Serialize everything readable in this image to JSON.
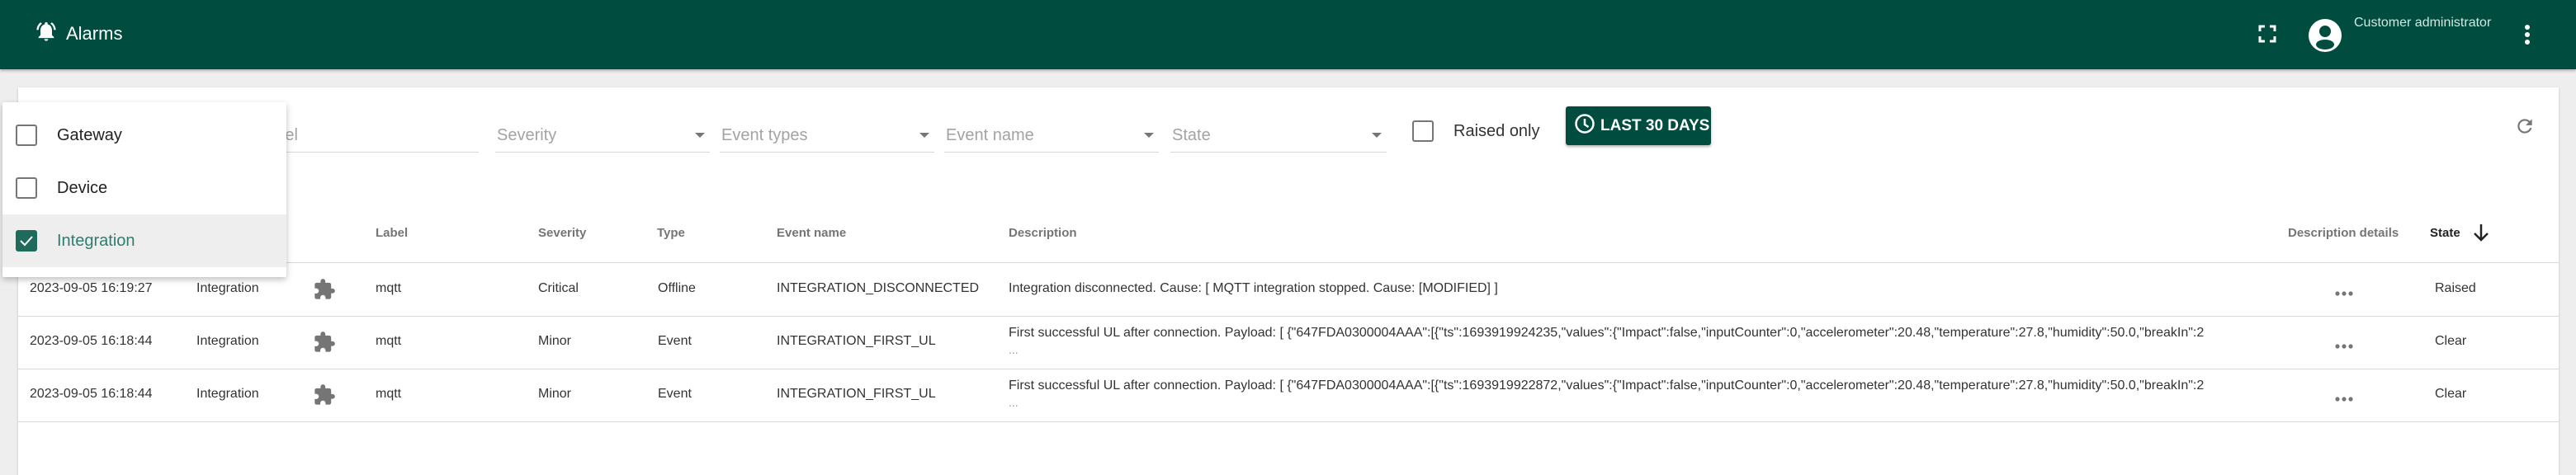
{
  "header": {
    "title": "Alarms",
    "title_icon": "alarm-bell-icon",
    "user_name": "Customer administrator",
    "fullscreen_icon": "fullscreen-icon",
    "avatar_icon": "account-circle-icon",
    "menu_icon": "more-vert-icon"
  },
  "filters": {
    "label_placeholder": "Label",
    "severity_placeholder": "Severity",
    "event_types_placeholder": "Event types",
    "event_name_placeholder": "Event name",
    "state_placeholder": "State",
    "raised_only_label": "Raised only",
    "raised_only_checked": false,
    "period_button_label": "LAST 30 DAYS",
    "period_icon": "clock-icon",
    "refresh_icon": "refresh-icon"
  },
  "entity_type_dropdown": {
    "options": [
      {
        "label": "Gateway",
        "checked": false
      },
      {
        "label": "Device",
        "checked": false
      },
      {
        "label": "Integration",
        "checked": true
      }
    ]
  },
  "table": {
    "columns": {
      "label": "Label",
      "severity": "Severity",
      "type": "Type",
      "event_name": "Event name",
      "description": "Description",
      "description_details": "Description details",
      "state": "State",
      "sort_icon": "arrow-down-icon"
    },
    "rows": [
      {
        "created_time": "2023-09-05 16:19:27",
        "entity_type": "Integration",
        "entity_icon": "puzzle-icon",
        "label": "mqtt",
        "severity": "Critical",
        "type": "Offline",
        "event_name": "INTEGRATION_DISCONNECTED",
        "description": "Integration disconnected. Cause: [ MQTT integration stopped. Cause: [MODIFIED] ]",
        "description_more": "",
        "state": "Raised"
      },
      {
        "created_time": "2023-09-05 16:18:44",
        "entity_type": "Integration",
        "entity_icon": "puzzle-icon",
        "label": "mqtt",
        "severity": "Minor",
        "type": "Event",
        "event_name": "INTEGRATION_FIRST_UL",
        "description": "First successful UL after connection. Payload: [ {\"647FDA0300004AAA\":[{\"ts\":1693919924235,\"values\":{\"Impact\":false,\"inputCounter\":0,\"accelerometer\":20.48,\"temperature\":27.8,\"humidity\":50.0,\"breakIn\":2",
        "description_more": "...",
        "state": "Clear"
      },
      {
        "created_time": "2023-09-05 16:18:44",
        "entity_type": "Integration",
        "entity_icon": "puzzle-icon",
        "label": "mqtt",
        "severity": "Minor",
        "type": "Event",
        "event_name": "INTEGRATION_FIRST_UL",
        "description": "First successful UL after connection. Payload: [ {\"647FDA0300004AAA\":[{\"ts\":1693919922872,\"values\":{\"Impact\":false,\"inputCounter\":0,\"accelerometer\":20.48,\"temperature\":27.8,\"humidity\":50.0,\"breakIn\":2",
        "description_more": "...",
        "state": "Clear"
      }
    ]
  },
  "colors": {
    "primary": "#004d40",
    "accent_selected": "#1e6b5c"
  }
}
